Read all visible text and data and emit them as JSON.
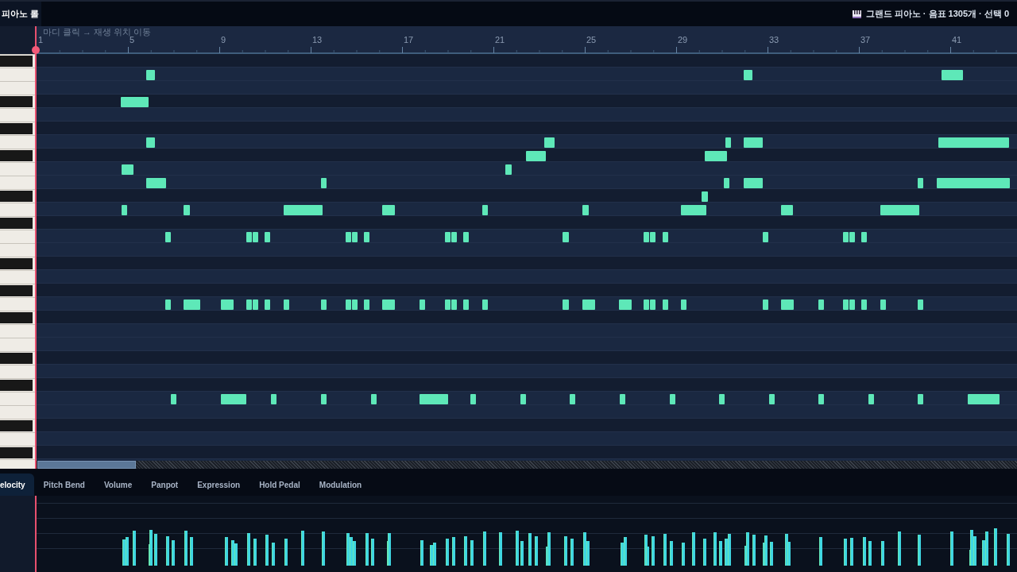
{
  "title_bar": {
    "title": "피아노 롤",
    "instrument_info": "그랜드 피아노 · 음표 1305개 · 선택 0"
  },
  "ruler": {
    "hint": "마디 클릭 → 재생 위치 이동",
    "bar_numbers": [
      "1",
      "5",
      "9",
      "13",
      "17",
      "21",
      "25",
      "29",
      "33",
      "37",
      "41"
    ]
  },
  "controller_tabs": [
    {
      "label": "elocity",
      "selected": true
    },
    {
      "label": "Pitch Bend",
      "selected": false
    },
    {
      "label": "Volume",
      "selected": false
    },
    {
      "label": "Panpot",
      "selected": false
    },
    {
      "label": "Expression",
      "selected": false
    },
    {
      "label": "Hold Pedal",
      "selected": false
    },
    {
      "label": "Modulation",
      "selected": false
    }
  ]
}
